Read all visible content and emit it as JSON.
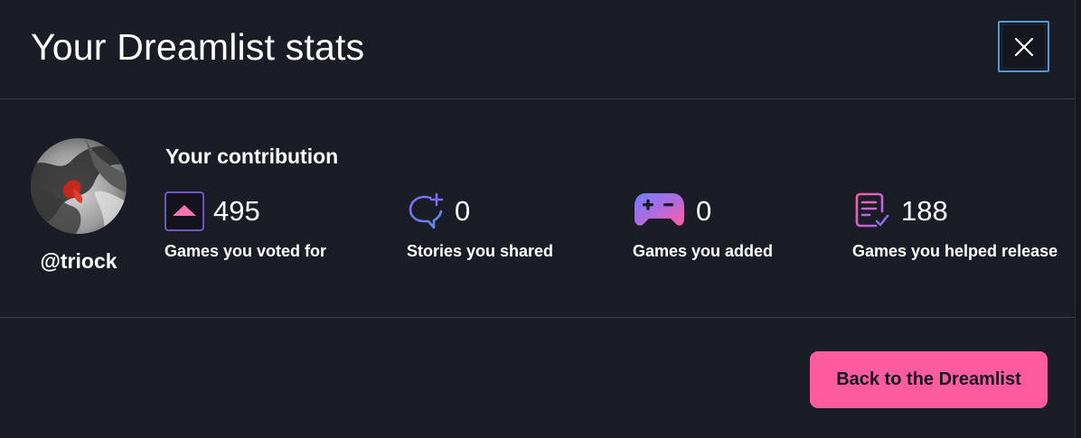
{
  "dialog": {
    "title": "Your Dreamlist stats",
    "close_icon": "close-icon"
  },
  "profile": {
    "username": "@triock",
    "avatar_icon": "avatar"
  },
  "contribution": {
    "title": "Your contribution",
    "stats": [
      {
        "icon": "upvote-icon",
        "value": "495",
        "label": "Games you voted for"
      },
      {
        "icon": "comment-plus-icon",
        "value": "0",
        "label": "Stories you shared"
      },
      {
        "icon": "gamepad-icon",
        "value": "0",
        "label": "Games you added"
      },
      {
        "icon": "checklist-icon",
        "value": "188",
        "label": "Games you helped release"
      }
    ]
  },
  "footer": {
    "back_button_label": "Back to the Dreamlist"
  },
  "colors": {
    "background": "#1a1d25",
    "accent_pink": "#ff5ca0",
    "accent_purple": "#7b6cf6",
    "divider": "#3a3e48",
    "focus_ring": "#4f9bd8"
  }
}
